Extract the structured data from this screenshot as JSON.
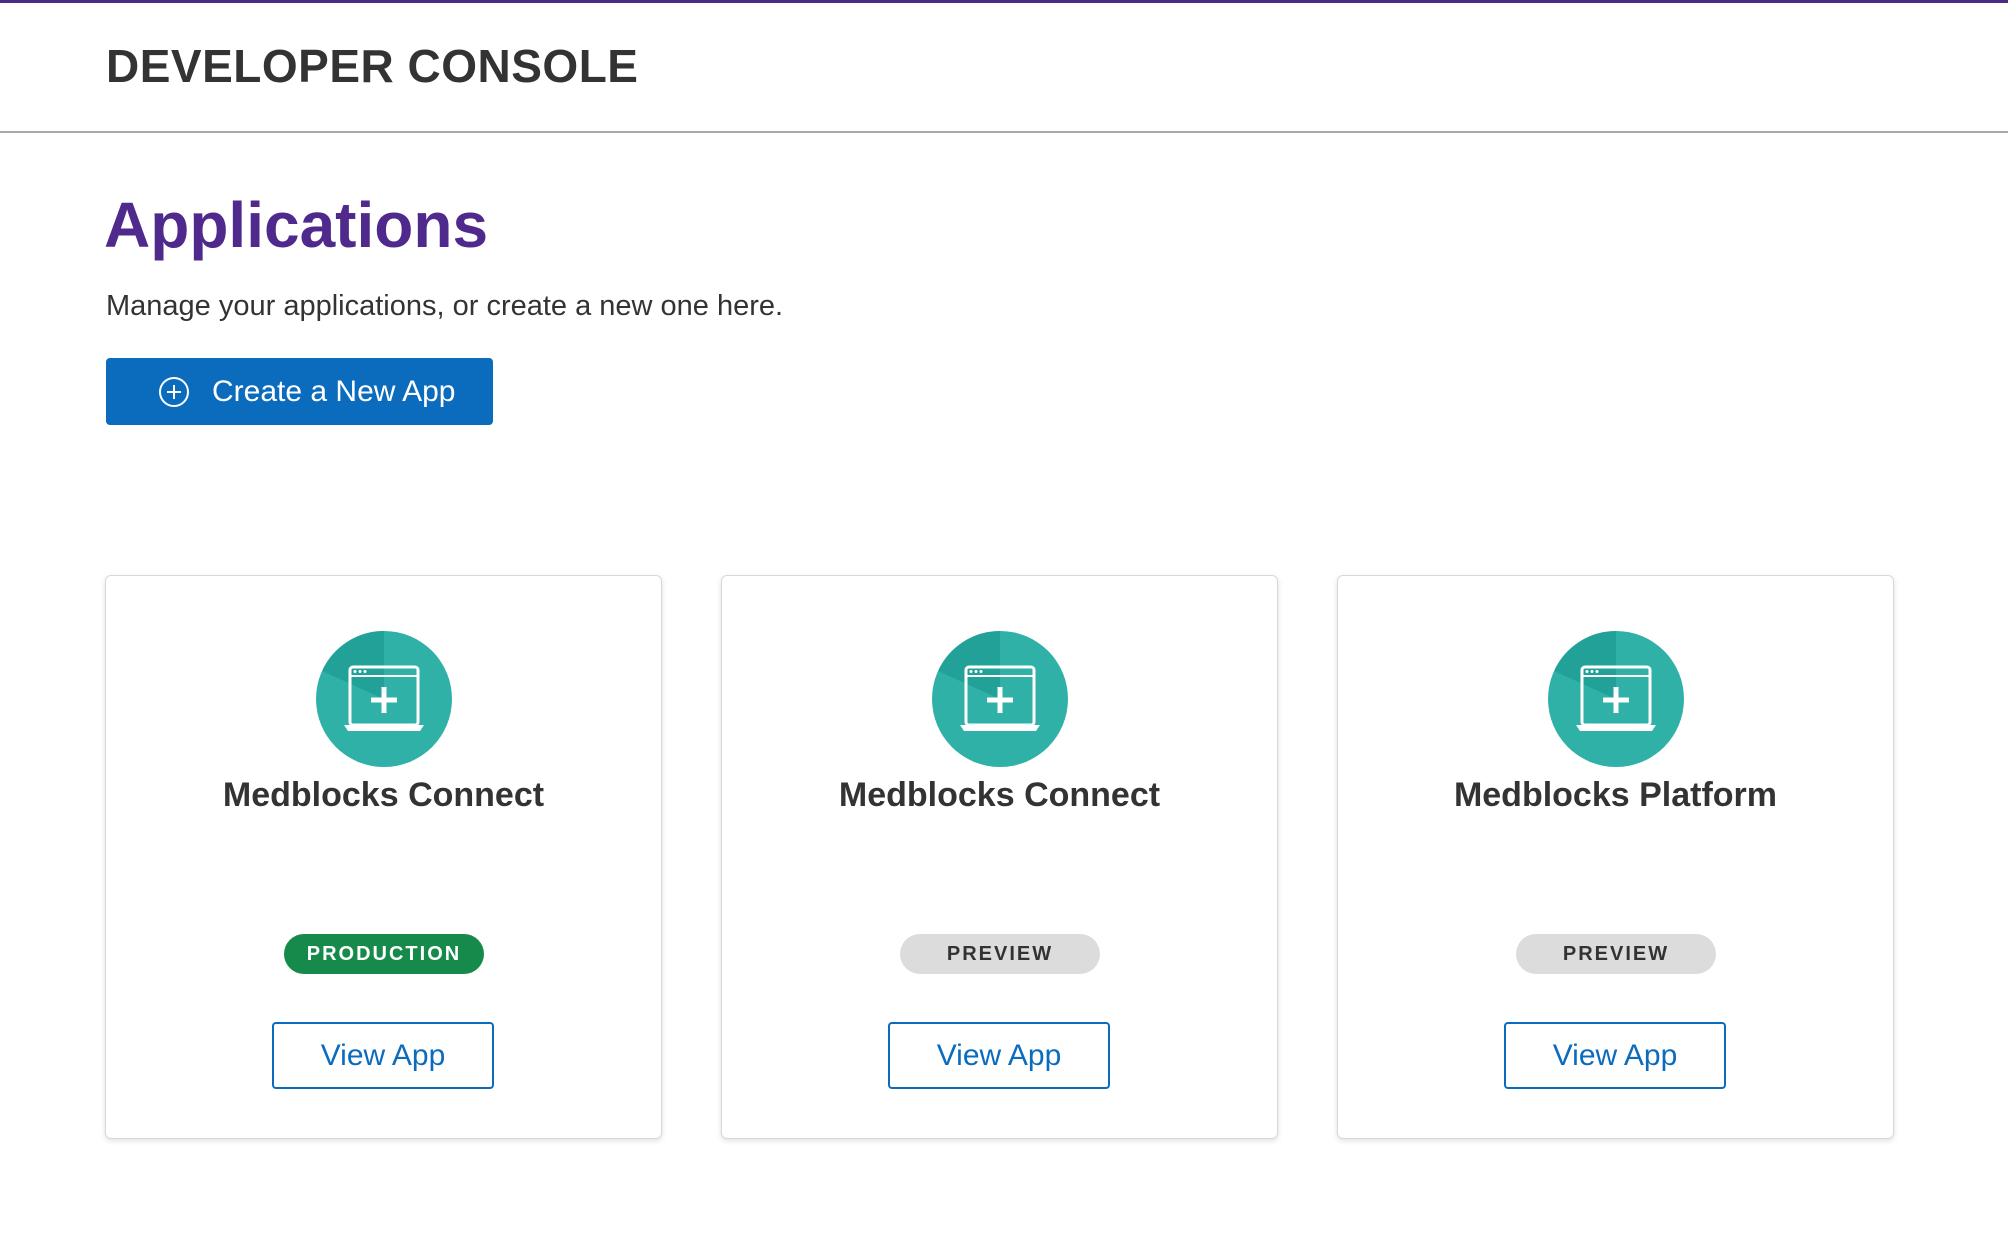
{
  "header": {
    "title": "DEVELOPER CONSOLE"
  },
  "page": {
    "title": "Applications",
    "subtitle": "Manage your applications, or create a new one here.",
    "create_button_label": "Create a New App"
  },
  "apps": [
    {
      "name": "Medblocks Connect",
      "status": "PRODUCTION",
      "action_label": "View App"
    },
    {
      "name": "Medblocks Connect",
      "status": "PREVIEW",
      "action_label": "View App"
    },
    {
      "name": "Medblocks Platform",
      "status": "PREVIEW",
      "action_label": "View App"
    }
  ],
  "icons": {
    "create_button": "plus-circle-icon",
    "app": "app-window-plus-icon"
  },
  "colors": {
    "brand_purple": "#4f2a8c",
    "primary_blue": "#0b6bbd",
    "teal": "#2fb1a8",
    "teal_dark": "#16938a",
    "production_green": "#168a4a",
    "preview_gray": "#dcdcdc"
  }
}
